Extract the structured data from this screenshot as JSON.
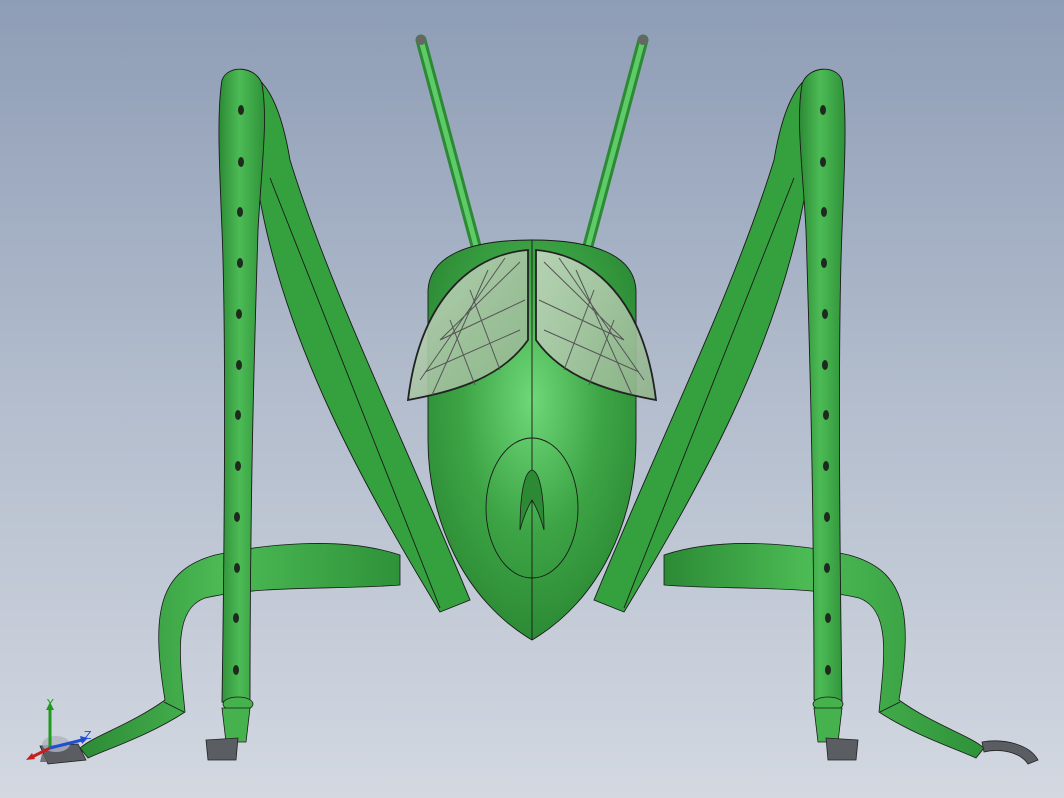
{
  "viewport": {
    "background_top": "#8e9db6",
    "background_bottom": "#d3d8e1"
  },
  "model": {
    "body_color": "#3da545",
    "body_shade": "#2c8a35",
    "body_highlight": "#6fd878",
    "eye_color": "#a9c8a4",
    "foot_color": "#5a5d62",
    "edge_color": "#111111"
  },
  "triad": {
    "y_label": "Y",
    "z_label": "Z",
    "y_color": "#1f9a1f",
    "x_color": "#c41e1e",
    "z_color": "#1e4fd0"
  }
}
